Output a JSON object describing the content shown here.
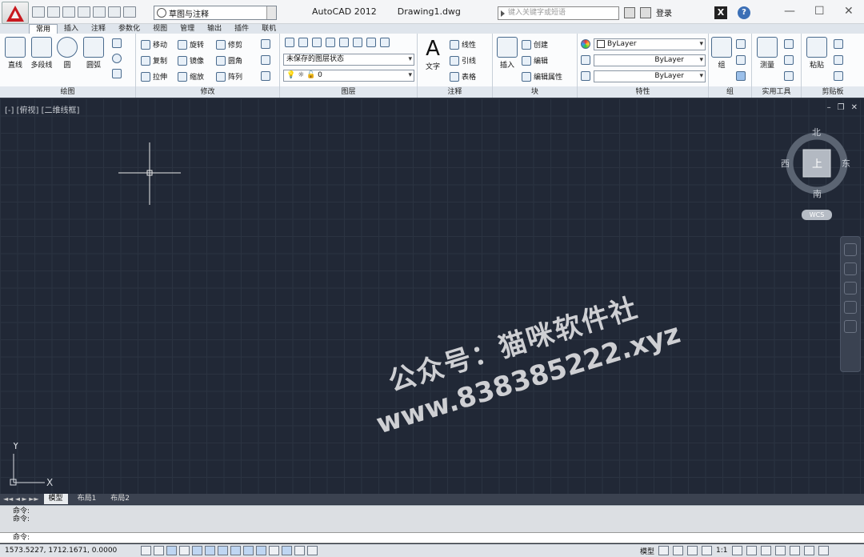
{
  "titlebar": {
    "app_title": "AutoCAD 2012",
    "doc_title": "Drawing1.dwg",
    "workspace": "草图与注释",
    "search_placeholder": "键入关键字或短语",
    "login": "登录"
  },
  "tabs": [
    "常用",
    "插入",
    "注释",
    "参数化",
    "视图",
    "管理",
    "输出",
    "插件",
    "联机"
  ],
  "ribbon": {
    "draw": {
      "title": "绘图",
      "items": [
        "直线",
        "多段线",
        "圆",
        "圆弧"
      ]
    },
    "modify": {
      "title": "修改",
      "items": [
        "移动",
        "旋转",
        "修剪",
        "复制",
        "镜像",
        "圆角",
        "拉伸",
        "缩放",
        "阵列"
      ]
    },
    "layers": {
      "title": "图层",
      "state": "未保存的图层状态",
      "layer": "0"
    },
    "annotation": {
      "title": "注释",
      "text": "文字",
      "items": [
        "线性",
        "引线",
        "表格"
      ]
    },
    "block": {
      "title": "块",
      "insert": "插入",
      "items": [
        "创建",
        "编辑",
        "编辑属性"
      ]
    },
    "properties": {
      "title": "特性",
      "color": "ByLayer",
      "linetype": "ByLayer",
      "lineweight": "ByLayer"
    },
    "groups": {
      "title": "组",
      "label": "组"
    },
    "utilities": {
      "title": "实用工具",
      "label": "测量"
    },
    "clipboard": {
      "title": "剪贴板",
      "label": "粘贴"
    }
  },
  "viewport": {
    "label": "[-] [俯视] [二维线框]",
    "viewcube": {
      "north": "北",
      "south": "南",
      "east": "东",
      "west": "西",
      "face": "上"
    },
    "wcs": "WCS",
    "ucs_x": "X",
    "ucs_y": "Y"
  },
  "watermark": {
    "line1": "公众号：猫咪软件社",
    "line2": "www.838385222.xyz"
  },
  "layout_tabs": [
    "模型",
    "布局1",
    "布局2"
  ],
  "command": {
    "history": [
      "命令:",
      "命令:"
    ],
    "prompt": "命令:"
  },
  "status": {
    "coords": "1573.5227,  1712.1671,  0.0000",
    "model": "模型",
    "scale": "1:1"
  }
}
